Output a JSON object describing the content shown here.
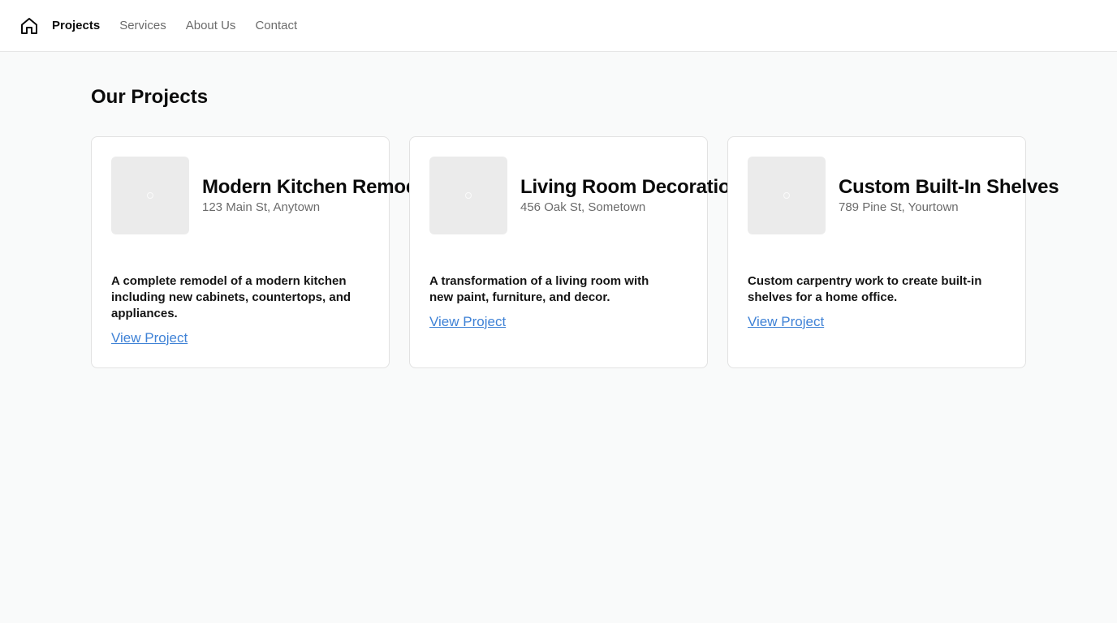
{
  "nav": {
    "home_icon": "home-icon",
    "items": [
      {
        "label": "Projects",
        "active": true
      },
      {
        "label": "Services",
        "active": false
      },
      {
        "label": "About Us",
        "active": false
      },
      {
        "label": "Contact",
        "active": false
      }
    ]
  },
  "page": {
    "title": "Our Projects"
  },
  "projects": [
    {
      "title": "Modern Kitchen Remodel",
      "address": "123 Main St, Anytown",
      "description": "A complete remodel of a modern kitchen including new cabinets, countertops, and appliances.",
      "link": "View Project"
    },
    {
      "title": "Living Room Decoration",
      "address": "456 Oak St, Sometown",
      "description": "A transformation of a living room with new paint, furniture, and decor.",
      "link": "View Project"
    },
    {
      "title": "Custom Built-In Shelves",
      "address": "789 Pine St, Yourtown",
      "description": "Custom carpentry work to create built-in shelves for a home office.",
      "link": "View Project"
    }
  ],
  "colors": {
    "link": "#3f82d6",
    "background": "#f9fafa",
    "thumb": "#ebebeb"
  }
}
